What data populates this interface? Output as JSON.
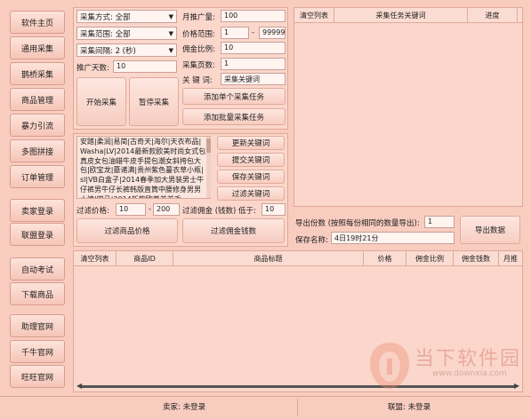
{
  "sidebar": {
    "items": [
      {
        "label": "软件主页"
      },
      {
        "label": "通用采集"
      },
      {
        "label": "鹊桥采集"
      },
      {
        "label": "商品管理"
      },
      {
        "label": "暴力引流"
      },
      {
        "label": "多图拼接"
      },
      {
        "label": "订单管理"
      },
      {
        "label": "卖家登录"
      },
      {
        "label": "联盟登录"
      },
      {
        "label": "自动考试"
      },
      {
        "label": "下载商品"
      },
      {
        "label": "助理官网"
      },
      {
        "label": "千牛官网"
      },
      {
        "label": "旺旺官网"
      }
    ]
  },
  "collect": {
    "method_value": "采集方式: 全部",
    "range_value": "采集范围: 全部",
    "interval_value": "采集间隔: 2 (秒)",
    "promo_days_label": "推广天数:",
    "promo_days_value": "10",
    "start_button": "开始采集",
    "pause_button": "暂停采集"
  },
  "params": {
    "monthly_label": "月推广量:",
    "monthly_value": "100",
    "price_label": "价格范围:",
    "price_min": "1",
    "price_sep": "-",
    "price_max": "99999",
    "commission_label": "佣金比例:",
    "commission_value": "10",
    "pages_label": "采集页数:",
    "pages_value": "1",
    "keyword_label": "关 键 词:",
    "keyword_value": "采集关键词",
    "add_single": "添加单个采集任务",
    "add_batch": "添加批量采集任务"
  },
  "task_table": {
    "columns": [
      "清空列表",
      "采集任务关键词",
      "进度"
    ]
  },
  "keywords": {
    "text": "安踏|柔润|易简|古奇天|海尔|天衣布品|Washa|LV|2014最新款欧美时尚女式包真皮女包油蜡牛皮手提包潮女斜挎包大包|欧宝龙|墓诸满|贵州紫色蔓衣草小瓶|sl|VB白盒子|2014春季加大男装男士牛仔裤男牛仔长裤韩版直筒中腰修身男男士裤|四马|2014新款欧美羊羊毛",
    "refresh": "更新关键词",
    "submit": "提交关键词",
    "save": "保存关键词",
    "filter": "过滤关键词",
    "filter_price_label": "过滤价格:",
    "filter_price_min": "10",
    "filter_price_sep": "-",
    "filter_price_max": "200",
    "filter_comm_label": "过滤佣金 (钱数) 低于:",
    "filter_comm_value": "10",
    "filter_price_button": "过滤商品价格",
    "filter_comm_button": "过滤佣金钱数"
  },
  "export": {
    "count_label": "导出份数 (按照每份相同的数量导出):",
    "count_value": "1",
    "save_label": "保存名称:",
    "save_value": "4日19时21分",
    "export_button": "导出数据"
  },
  "product_table": {
    "columns": [
      "清空列表",
      "商品ID",
      "商品标题",
      "价格",
      "佣金比例",
      "佣金钱数",
      "月推"
    ]
  },
  "status": {
    "seller": "卖家: 未登录",
    "union": "联盟: 未登录"
  },
  "watermark": {
    "title": "当下软件园",
    "url": "www.downxia.com"
  }
}
